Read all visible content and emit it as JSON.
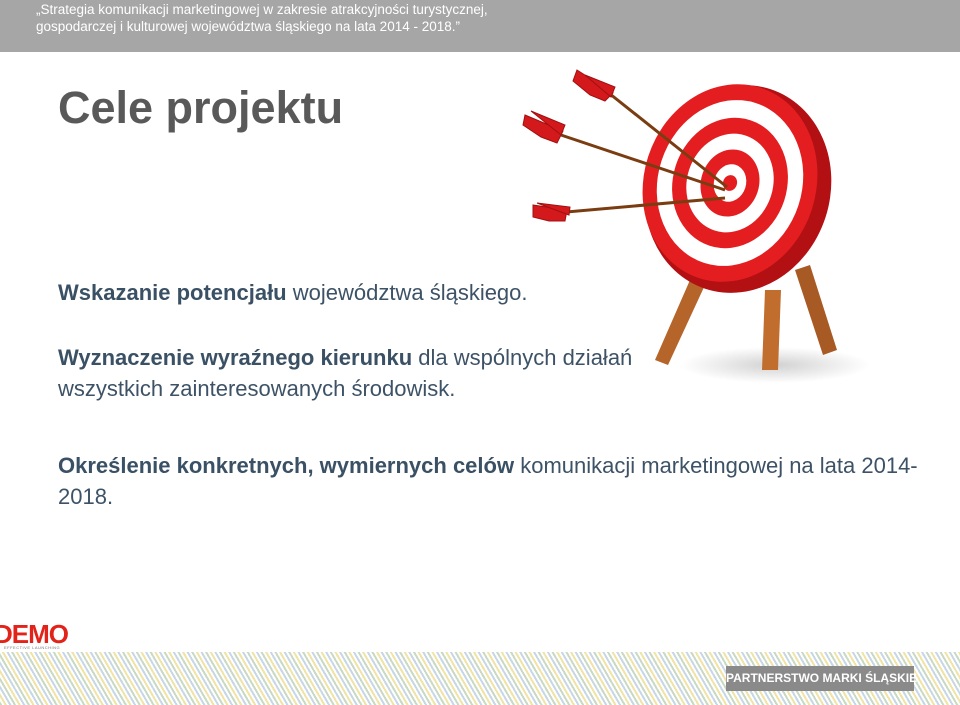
{
  "header": {
    "line1": "„Strategia komunikacji marketingowej w zakresie atrakcyjności turystycznej,",
    "line2": "gospodarczej i kulturowej województwa śląskiego na lata 2014 - 2018.”"
  },
  "slide": {
    "title": "Cele projektu",
    "points": [
      {
        "bold": "Wskazanie potencjału",
        "normal": " województwa śląskiego."
      },
      {
        "bold": "Wyznaczenie wyraźnego kierunku",
        "normal": " dla wspólnych działań wszystkich zainteresowanych środowisk."
      },
      {
        "bold": "Określenie konkretnych, wymiernych celów",
        "normal": " komunikacji marketingowej na lata 2014-2018."
      }
    ]
  },
  "footer": {
    "logo_text": "DEMO",
    "logo_subtext": "EFFECTIVE LAUNCHING",
    "partner_label": "PARTNERSTWO MARKI ŚLĄSKIE"
  },
  "colors": {
    "header_bg": "#a6a6a6",
    "title": "#595959",
    "body_text": "#3d5266",
    "accent_red": "#e2231a",
    "badge_bg": "#8a8a8a"
  },
  "icons": {
    "illustration": "target-with-arrows-icon"
  }
}
